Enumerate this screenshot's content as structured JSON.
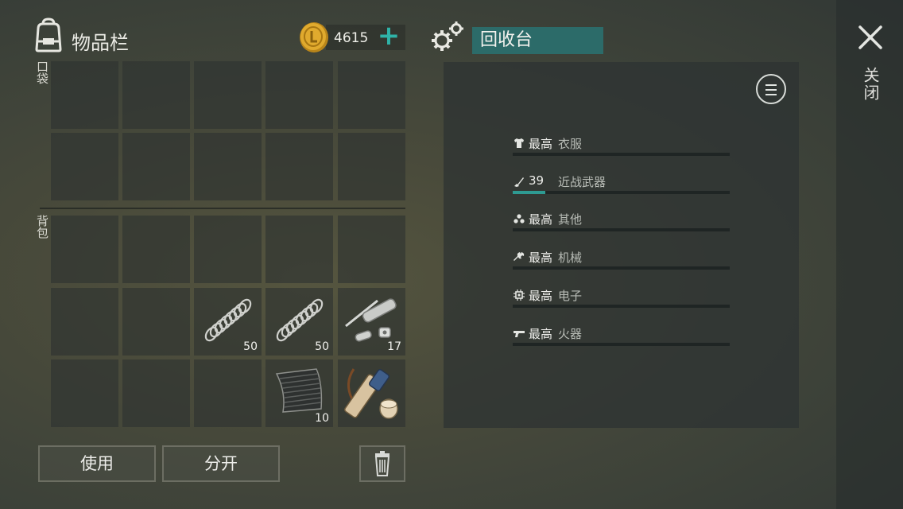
{
  "header": {
    "inventory_title": "物品栏",
    "coin_count": "4615",
    "add_label": "+",
    "recycler_title": "回收台",
    "close_label": "关闭"
  },
  "sections": {
    "pocket_label": "口袋",
    "backpack_label": "背包"
  },
  "backpack_items": [
    {
      "row": 1,
      "col": 2,
      "icon": "spring-icon",
      "qty": "50"
    },
    {
      "row": 1,
      "col": 3,
      "icon": "spring-icon",
      "qty": "50"
    },
    {
      "row": 1,
      "col": 4,
      "icon": "pipe-parts-icon",
      "qty": "17"
    },
    {
      "row": 2,
      "col": 3,
      "icon": "rubber-sheet-icon",
      "qty": "10"
    },
    {
      "row": 2,
      "col": 4,
      "icon": "scope-tube-icon",
      "qty": ""
    }
  ],
  "buttons": {
    "use": "使用",
    "split": "分开"
  },
  "recycler": {
    "rows": [
      {
        "icon": "shirt-icon",
        "level": "最高",
        "category": "衣服",
        "progress": 0
      },
      {
        "icon": "knife-icon",
        "level": "39",
        "category": "近战武器",
        "progress": 0.15
      },
      {
        "icon": "dots-icon",
        "level": "最高",
        "category": "其他",
        "progress": 0
      },
      {
        "icon": "wrench-icon",
        "level": "最高",
        "category": "机械",
        "progress": 0
      },
      {
        "icon": "chip-icon",
        "level": "最高",
        "category": "电子",
        "progress": 0
      },
      {
        "icon": "gun-icon",
        "level": "最高",
        "category": "火器",
        "progress": 0
      }
    ]
  },
  "colors": {
    "accent": "#2fb3a8",
    "title_bg": "#2c6b69",
    "coin": "#d9a326"
  }
}
